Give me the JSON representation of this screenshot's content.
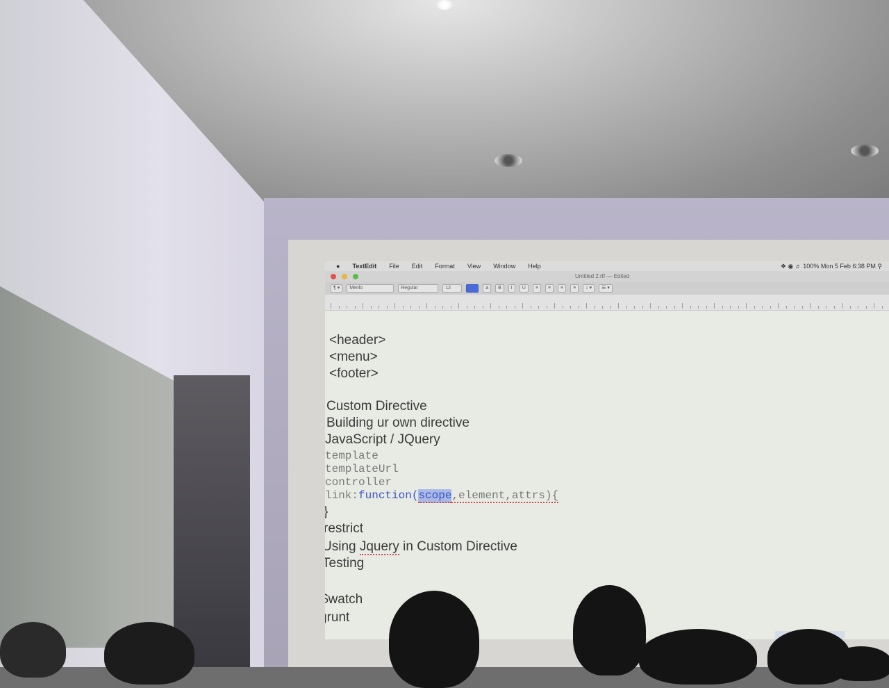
{
  "menubar": {
    "apple": "",
    "app_name": "TextEdit",
    "items": [
      "File",
      "Edit",
      "Format",
      "View",
      "Window",
      "Help"
    ],
    "battery": "100%",
    "clock": "Mon 5 Feb  6:38 PM"
  },
  "window": {
    "title": "Untitled 2.rtf",
    "edited": "— Edited"
  },
  "toolbar": {
    "font": "Menlo",
    "style": "Regular",
    "size": "12"
  },
  "document": {
    "lines": [
      {
        "text": "<header>",
        "kind": "text"
      },
      {
        "text": "<menu>",
        "kind": "text"
      },
      {
        "text": "<footer>",
        "kind": "text"
      },
      {
        "text": "Custom Directive",
        "kind": "text"
      },
      {
        "text": "Building ur own directive",
        "kind": "text"
      },
      {
        "text": "JavaScript / JQuery",
        "kind": "text"
      },
      {
        "text": "template",
        "kind": "code"
      },
      {
        "text": "templateUrl",
        "kind": "code"
      },
      {
        "text": "controller",
        "kind": "code"
      },
      {
        "text": "}",
        "kind": "text"
      },
      {
        "text": "restrict",
        "kind": "text"
      },
      {
        "text": "Testing",
        "kind": "text"
      },
      {
        "text": "$watch",
        "kind": "text"
      },
      {
        "text": "grunt",
        "kind": "text"
      }
    ],
    "link_line": {
      "prefix": "link:",
      "keyword": "function(",
      "selected": "scope",
      "rest": ",element,attrs){"
    },
    "jquery_line": {
      "before": "Using ",
      "misspelled": "Jquery",
      "after": " in Custom Directive"
    }
  },
  "colors": {
    "screen_bg": "#e7ebe3",
    "code_keyword": "#3d54c4",
    "selection": "#a9b8e6"
  }
}
